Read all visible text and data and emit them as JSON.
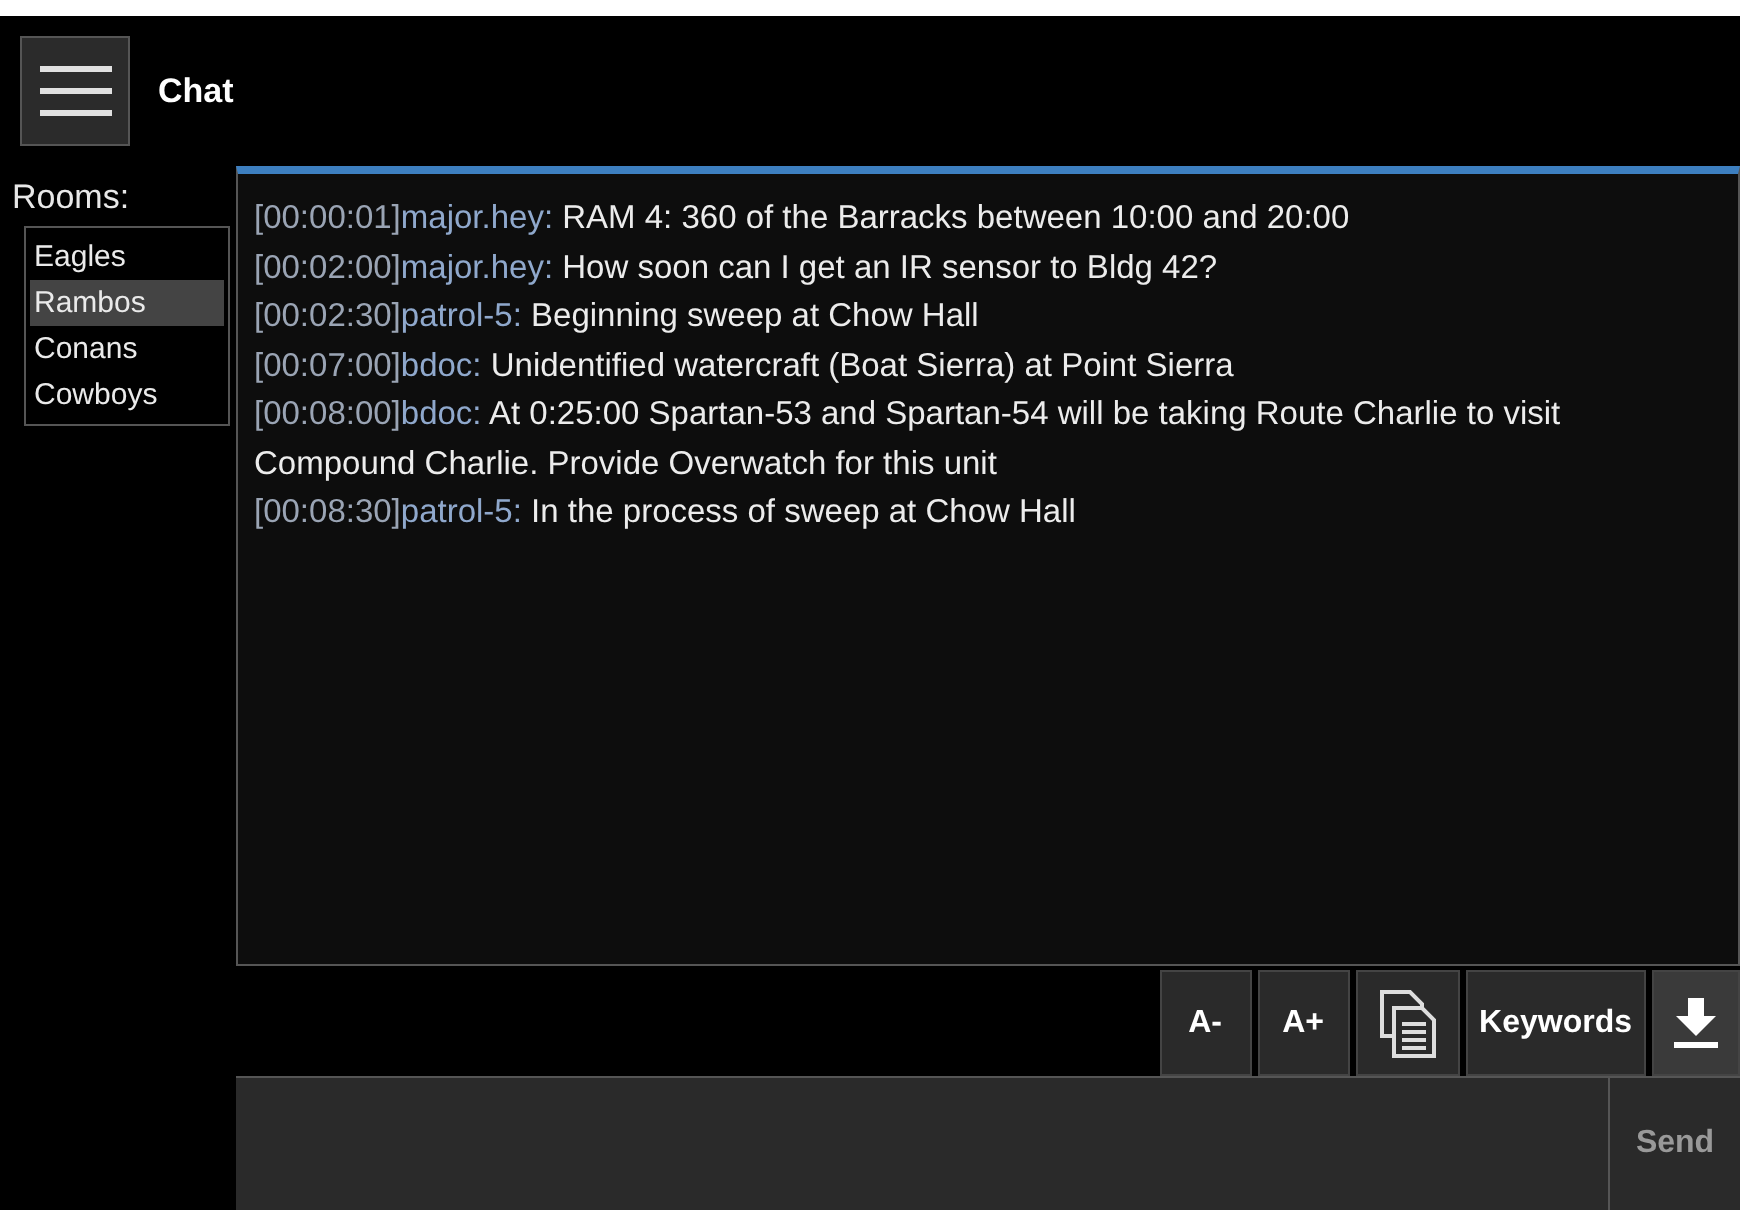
{
  "header": {
    "title": "Chat"
  },
  "rooms": {
    "label": "Rooms:",
    "items": [
      {
        "name": "Eagles",
        "selected": false
      },
      {
        "name": "Rambos",
        "selected": true
      },
      {
        "name": "Conans",
        "selected": false
      },
      {
        "name": "Cowboys",
        "selected": false
      }
    ]
  },
  "messages": [
    {
      "time": "[00:00:01]",
      "sender": "major.hey:",
      "text": "RAM 4: 360 of the Barracks between 10:00 and 20:00"
    },
    {
      "time": "[00:02:00]",
      "sender": "major.hey:",
      "text": "How soon can I get an IR sensor to Bldg 42?"
    },
    {
      "time": "[00:02:30]",
      "sender": "patrol-5:",
      "text": "Beginning sweep at Chow Hall"
    },
    {
      "time": "[00:07:00]",
      "sender": "bdoc:",
      "text": "Unidentified watercraft (Boat Sierra) at Point Sierra"
    },
    {
      "time": "[00:08:00]",
      "sender": "bdoc:",
      "text": "At 0:25:00  Spartan-53 and Spartan-54 will be taking Route Charlie to visit Compound Charlie.  Provide Overwatch for this unit"
    },
    {
      "time": "[00:08:30]",
      "sender": "patrol-5:",
      "text": "In the process of sweep at Chow Hall"
    }
  ],
  "toolbar": {
    "font_smaller": "A-",
    "font_larger": "A+",
    "keywords": "Keywords"
  },
  "composer": {
    "send": "Send"
  }
}
